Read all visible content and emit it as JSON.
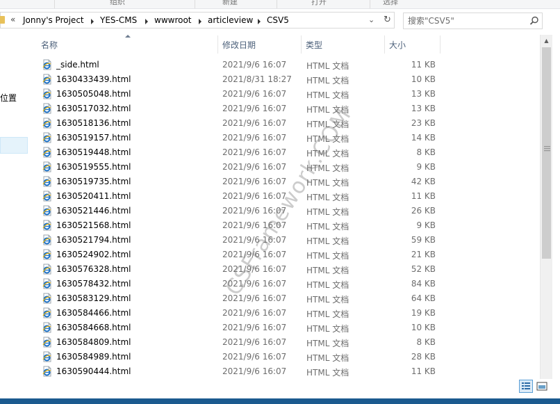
{
  "ribbon": {
    "labels": [
      "组织",
      "新建",
      "打开",
      "选择"
    ]
  },
  "address": {
    "chevrons": "«",
    "crumbs": [
      "Jonny's Project",
      "YES-CMS",
      "wwwroot",
      "articleview",
      "CSV5"
    ]
  },
  "search": {
    "placeholder": "搜索\"CSV5\""
  },
  "nav": {
    "partial_label": "位置"
  },
  "columns": {
    "name": "名称",
    "date": "修改日期",
    "type": "类型",
    "size": "大小"
  },
  "files": [
    {
      "name": "_side.html",
      "date": "2021/9/6 16:07",
      "type": "HTML 文档",
      "size": "11 KB"
    },
    {
      "name": "1630433439.html",
      "date": "2021/8/31 18:27",
      "type": "HTML 文档",
      "size": "10 KB"
    },
    {
      "name": "1630505048.html",
      "date": "2021/9/6 16:07",
      "type": "HTML 文档",
      "size": "13 KB"
    },
    {
      "name": "1630517032.html",
      "date": "2021/9/6 16:07",
      "type": "HTML 文档",
      "size": "13 KB"
    },
    {
      "name": "1630518136.html",
      "date": "2021/9/6 16:07",
      "type": "HTML 文档",
      "size": "23 KB"
    },
    {
      "name": "1630519157.html",
      "date": "2021/9/6 16:07",
      "type": "HTML 文档",
      "size": "14 KB"
    },
    {
      "name": "1630519448.html",
      "date": "2021/9/6 16:07",
      "type": "HTML 文档",
      "size": "8 KB"
    },
    {
      "name": "1630519555.html",
      "date": "2021/9/6 16:07",
      "type": "HTML 文档",
      "size": "9 KB"
    },
    {
      "name": "1630519735.html",
      "date": "2021/9/6 16:07",
      "type": "HTML 文档",
      "size": "42 KB"
    },
    {
      "name": "1630520411.html",
      "date": "2021/9/6 16:07",
      "type": "HTML 文档",
      "size": "11 KB"
    },
    {
      "name": "1630521446.html",
      "date": "2021/9/6 16:07",
      "type": "HTML 文档",
      "size": "26 KB"
    },
    {
      "name": "1630521568.html",
      "date": "2021/9/6 16:07",
      "type": "HTML 文档",
      "size": "9 KB"
    },
    {
      "name": "1630521794.html",
      "date": "2021/9/6 16:07",
      "type": "HTML 文档",
      "size": "59 KB"
    },
    {
      "name": "1630524902.html",
      "date": "2021/9/6 16:07",
      "type": "HTML 文档",
      "size": "21 KB"
    },
    {
      "name": "1630576328.html",
      "date": "2021/9/6 16:07",
      "type": "HTML 文档",
      "size": "52 KB"
    },
    {
      "name": "1630578432.html",
      "date": "2021/9/6 16:07",
      "type": "HTML 文档",
      "size": "84 KB"
    },
    {
      "name": "1630583129.html",
      "date": "2021/9/6 16:07",
      "type": "HTML 文档",
      "size": "64 KB"
    },
    {
      "name": "1630584466.html",
      "date": "2021/9/6 16:07",
      "type": "HTML 文档",
      "size": "19 KB"
    },
    {
      "name": "1630584668.html",
      "date": "2021/9/6 16:07",
      "type": "HTML 文档",
      "size": "10 KB"
    },
    {
      "name": "1630584809.html",
      "date": "2021/9/6 16:07",
      "type": "HTML 文档",
      "size": "8 KB"
    },
    {
      "name": "1630584989.html",
      "date": "2021/9/6 16:07",
      "type": "HTML 文档",
      "size": "28 KB"
    },
    {
      "name": "1630590444.html",
      "date": "2021/9/6 16:07",
      "type": "HTML 文档",
      "size": "11 KB"
    }
  ],
  "watermark": "CSFramework.COM",
  "icons": {
    "file": "ie-html-file-icon",
    "search": "search-icon",
    "refresh": "refresh-icon",
    "dropdown": "chevron-down-icon",
    "details_view": "details-view-icon",
    "tiles_view": "large-icons-view-icon"
  },
  "colors": {
    "accent": "#1b5a8f",
    "header_text": "#4c607a",
    "folder": "#e8c15a"
  }
}
